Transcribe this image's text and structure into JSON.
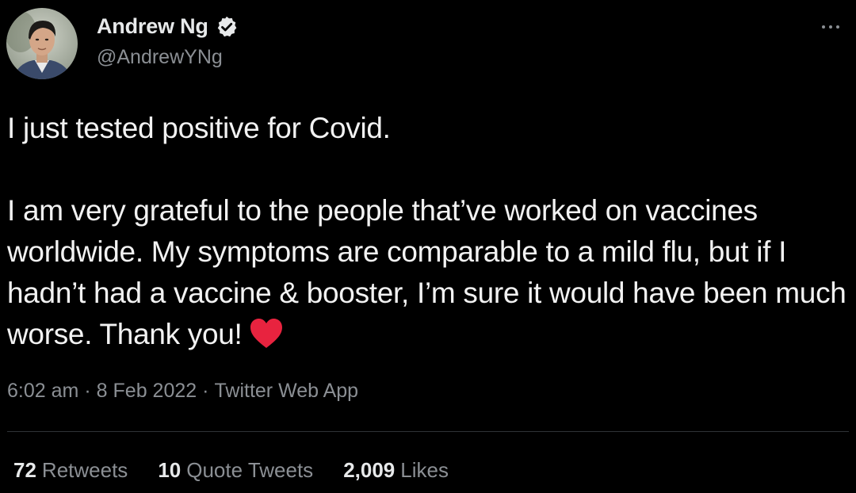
{
  "author": {
    "display_name": "Andrew Ng",
    "handle": "@AndrewYNg",
    "verified": true,
    "avatar_icon": "profile-photo"
  },
  "tweet": {
    "paragraph_1": "I just tested positive for Covid.",
    "paragraph_2": "I am very grateful to the people that’ve worked on vaccines worldwide. My symptoms are comparable to a mild flu, but if I hadn’t had a vaccine & booster, I’m sure it would have been much worse. Thank you!",
    "emoji": "red-heart"
  },
  "meta": {
    "time": "6:02 am",
    "date": "8 Feb 2022",
    "source": "Twitter Web App",
    "separator": "·"
  },
  "stats": {
    "retweets_count": "72",
    "retweets_label": "Retweets",
    "quotes_count": "10",
    "quotes_label": "Quote Tweets",
    "likes_count": "2,009",
    "likes_label": "Likes"
  },
  "colors": {
    "background": "#000000",
    "text_primary": "#e7e9ea",
    "text_secondary": "#8b8f94",
    "heart": "#e8233f",
    "divider": "#2f3336"
  }
}
